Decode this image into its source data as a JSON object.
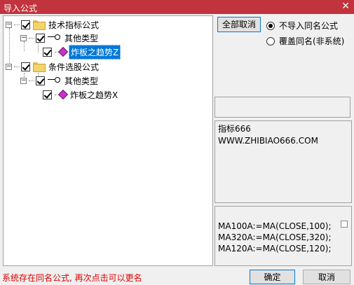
{
  "window": {
    "title": "导入公式",
    "close_glyph": "✕"
  },
  "tree": {
    "groups": [
      {
        "expander": "−",
        "label": "技术指标公式",
        "checked": true,
        "type": {
          "expander": "−",
          "label": "其他类型",
          "checked": true,
          "formula": {
            "label": "炸板之趋势Z",
            "checked": true,
            "selected": true
          }
        }
      },
      {
        "expander": "−",
        "label": "条件选股公式",
        "checked": true,
        "type": {
          "expander": "−",
          "label": "其他类型",
          "checked": true,
          "formula": {
            "label": "炸板之趋势X",
            "checked": true,
            "selected": false
          }
        }
      }
    ]
  },
  "options": {
    "deselect_all_label": "全部取消",
    "radio_no_import_label": "不导入同名公式",
    "radio_overwrite_label": "覆盖同名(非系统)",
    "selected_radio": "no_import"
  },
  "description": {
    "line1": "指标666",
    "line2": "WWW.ZHIBIAO666.COM"
  },
  "formula_code": {
    "line1": "MA100A:=MA(CLOSE,100);",
    "line2": "MA320A:=MA(CLOSE,320);",
    "line3": "MA120A:=MA(CLOSE,120);"
  },
  "footer": {
    "status": "系统存在同名公式, 再次点击可以更名",
    "ok_label": "确定",
    "cancel_label": "取消"
  },
  "colors": {
    "titlebar": "#c1343d",
    "selection": "#0078d7",
    "status_text": "#e00000"
  }
}
